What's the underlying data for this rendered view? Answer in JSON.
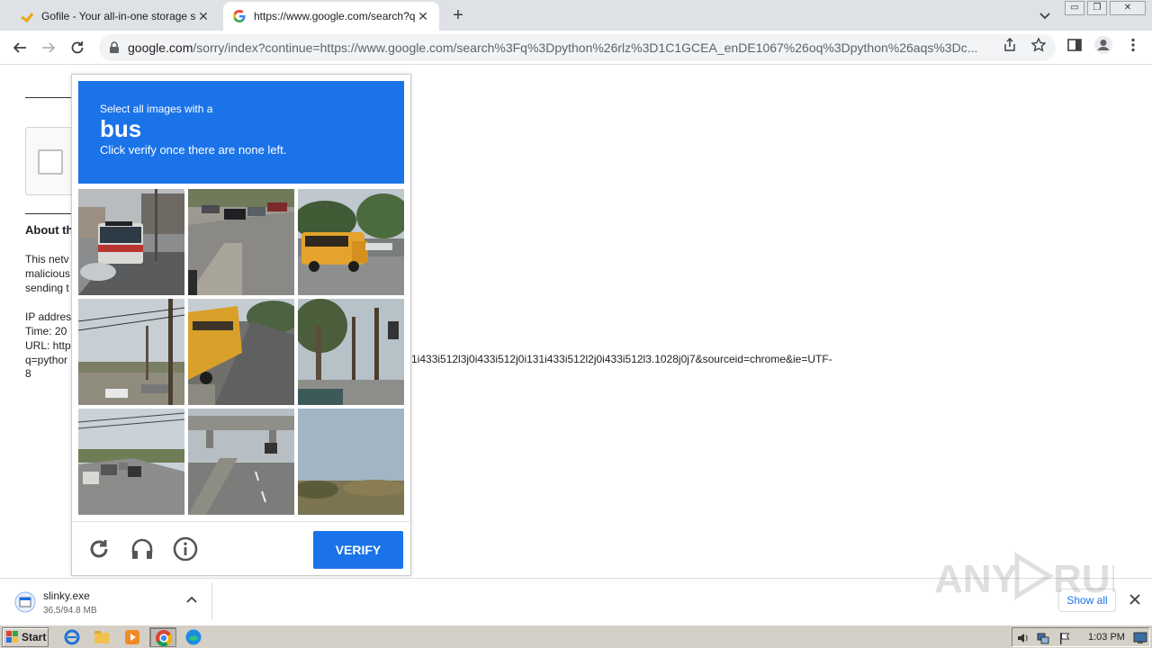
{
  "browser": {
    "tabs": [
      {
        "title": "Gofile - Your all-in-one storage soluti",
        "active": false
      },
      {
        "title": "https://www.google.com/search?q=",
        "active": true
      }
    ],
    "url_host": "google.com",
    "url_rest": "/sorry/index?continue=https://www.google.com/search%3Fq%3Dpython%26rlz%3D1C1GCEA_enDE1067%26oq%3Dpython%26aqs%3Dc..."
  },
  "page": {
    "about_heading": "About th",
    "para_lines": [
      "This netv",
      "malicious",
      "sending t"
    ],
    "ip_lines": [
      "IP addres",
      "Time: 20",
      "URL: http",
      "q=pythor"
    ],
    "url_continuation": "1i433i512l3j0i433i512j0i131i433i512l2j0i433i512l3.1028j0j7&sourceid=chrome&ie=UTF-",
    "url_end": "8"
  },
  "captcha": {
    "instruction_small": "Select all images with a",
    "target": "bus",
    "instruction": "Click verify once there are none left.",
    "verify_label": "VERIFY",
    "accent": "#1a73e8"
  },
  "download": {
    "filename": "slinky.exe",
    "progress": "36.5/94.8 MB",
    "show_all": "Show all"
  },
  "taskbar": {
    "start_label": "Start",
    "clock": "1:03 PM"
  }
}
